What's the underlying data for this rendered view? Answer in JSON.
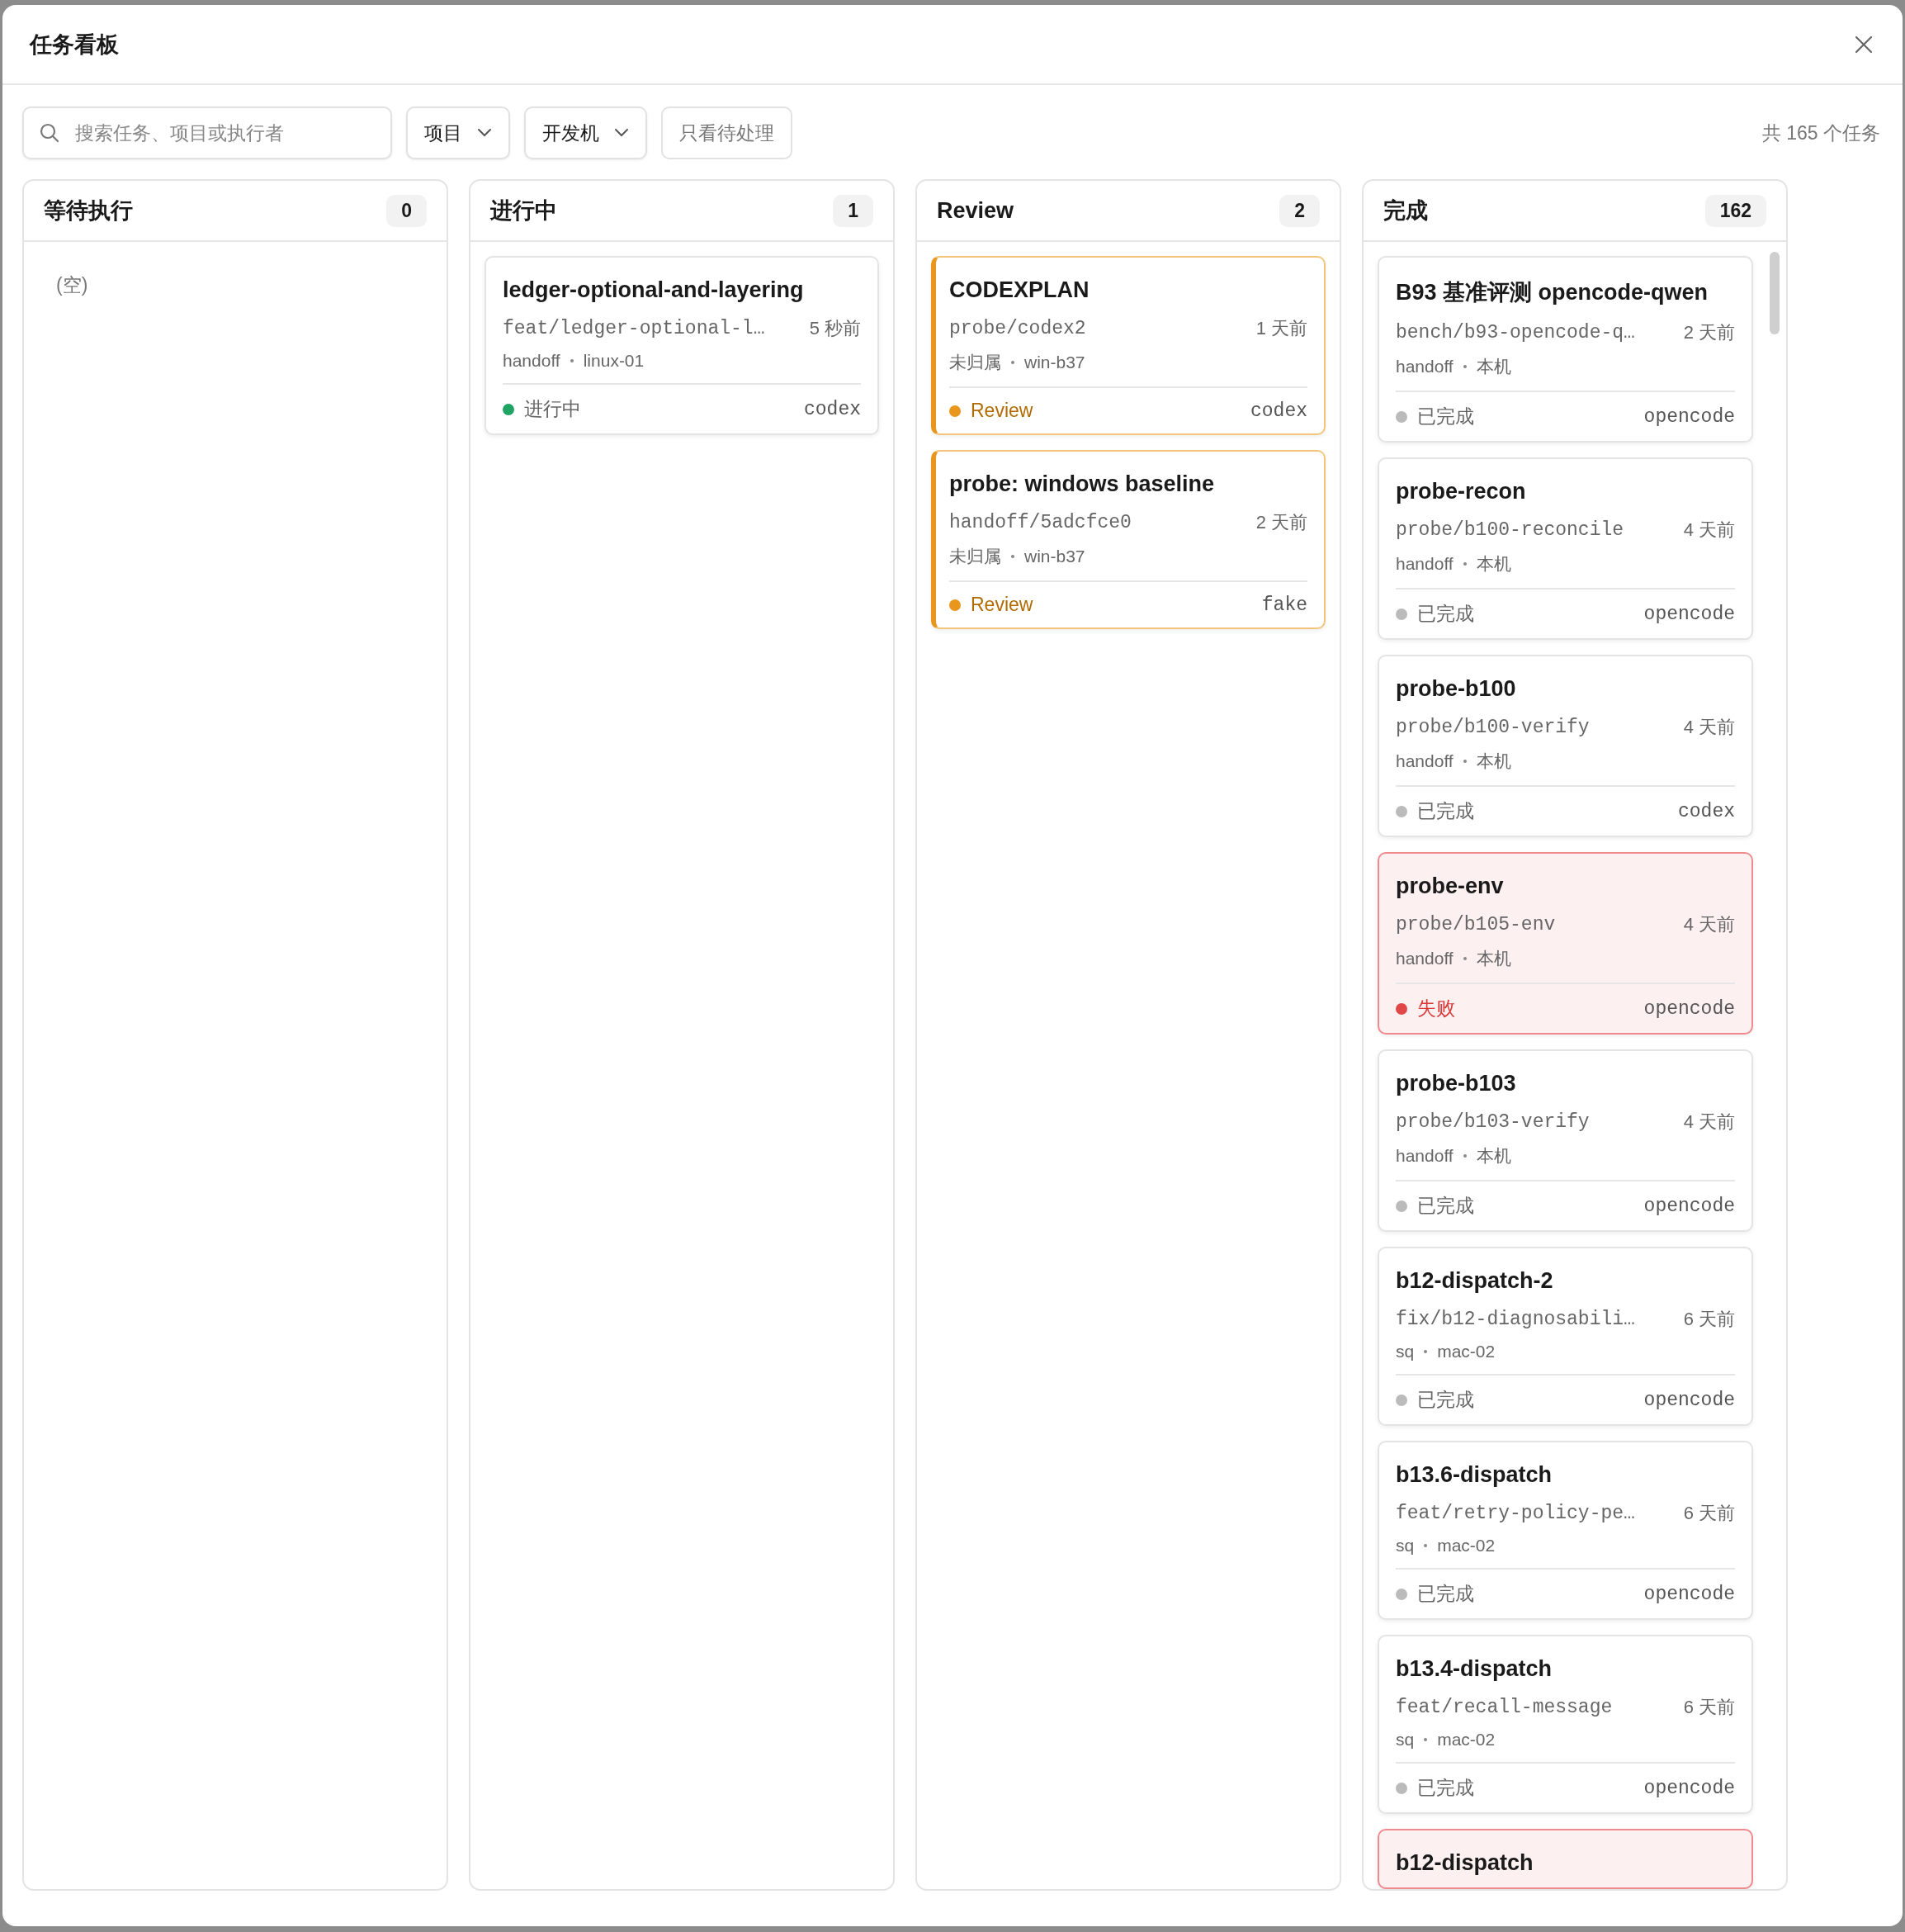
{
  "window": {
    "title": "任务看板"
  },
  "toolbar": {
    "search": {
      "placeholder": "搜索任务、项目或执行者"
    },
    "filters": [
      {
        "label": "项目",
        "kind": "dropdown"
      },
      {
        "label": "开发机",
        "kind": "dropdown"
      },
      {
        "label": "只看待处理",
        "kind": "toggle",
        "on": false
      }
    ],
    "total": "共 165 个任务"
  },
  "columns": [
    {
      "title": "等待执行",
      "count": "0",
      "empty_text": "(空)",
      "scrollable": false
    },
    {
      "title": "进行中",
      "count": "1",
      "scrollable": false,
      "cards": [
        {
          "title": "ledger-optional-and-layering",
          "branch": "feat/ledger-optional-l…",
          "time": "5 秒前",
          "owner": "handoff",
          "host": "linux-01",
          "kind": "running",
          "status_label": "进行中",
          "agent": "codex"
        }
      ]
    },
    {
      "title": "Review",
      "count": "2",
      "scrollable": false,
      "cards": [
        {
          "title": "CODEXPLAN",
          "branch": "probe/codex2",
          "time": "1 天前",
          "owner": "未归属",
          "host": "win-b37",
          "kind": "review",
          "status_label": "Review",
          "agent": "codex"
        },
        {
          "title": "probe: windows baseline",
          "branch": "handoff/5adcfce0",
          "time": "2 天前",
          "owner": "未归属",
          "host": "win-b37",
          "kind": "review",
          "status_label": "Review",
          "agent": "fake"
        }
      ]
    },
    {
      "title": "完成",
      "count": "162",
      "scrollable": true,
      "cards": [
        {
          "title": "B93 基准评测 opencode-qwen",
          "branch": "bench/b93-opencode-q…",
          "time": "2 天前",
          "owner": "handoff",
          "host": "本机",
          "kind": "done",
          "status_label": "已完成",
          "agent": "opencode"
        },
        {
          "title": "probe-recon",
          "branch": "probe/b100-reconcile",
          "time": "4 天前",
          "owner": "handoff",
          "host": "本机",
          "kind": "done",
          "status_label": "已完成",
          "agent": "opencode"
        },
        {
          "title": "probe-b100",
          "branch": "probe/b100-verify",
          "time": "4 天前",
          "owner": "handoff",
          "host": "本机",
          "kind": "done",
          "status_label": "已完成",
          "agent": "codex"
        },
        {
          "title": "probe-env",
          "branch": "probe/b105-env",
          "time": "4 天前",
          "owner": "handoff",
          "host": "本机",
          "kind": "failed",
          "status_label": "失败",
          "agent": "opencode"
        },
        {
          "title": "probe-b103",
          "branch": "probe/b103-verify",
          "time": "4 天前",
          "owner": "handoff",
          "host": "本机",
          "kind": "done",
          "status_label": "已完成",
          "agent": "opencode"
        },
        {
          "title": "b12-dispatch-2",
          "branch": "fix/b12-diagnosabili…",
          "time": "6 天前",
          "owner": "sq",
          "host": "mac-02",
          "kind": "done",
          "status_label": "已完成",
          "agent": "opencode"
        },
        {
          "title": "b13.6-dispatch",
          "branch": "feat/retry-policy-pe…",
          "time": "6 天前",
          "owner": "sq",
          "host": "mac-02",
          "kind": "done",
          "status_label": "已完成",
          "agent": "opencode"
        },
        {
          "title": "b13.4-dispatch",
          "branch": "feat/recall-message",
          "time": "6 天前",
          "owner": "sq",
          "host": "mac-02",
          "kind": "done",
          "status_label": "已完成",
          "agent": "opencode"
        },
        {
          "title": "b12-dispatch",
          "kind": "failed"
        }
      ]
    }
  ]
}
